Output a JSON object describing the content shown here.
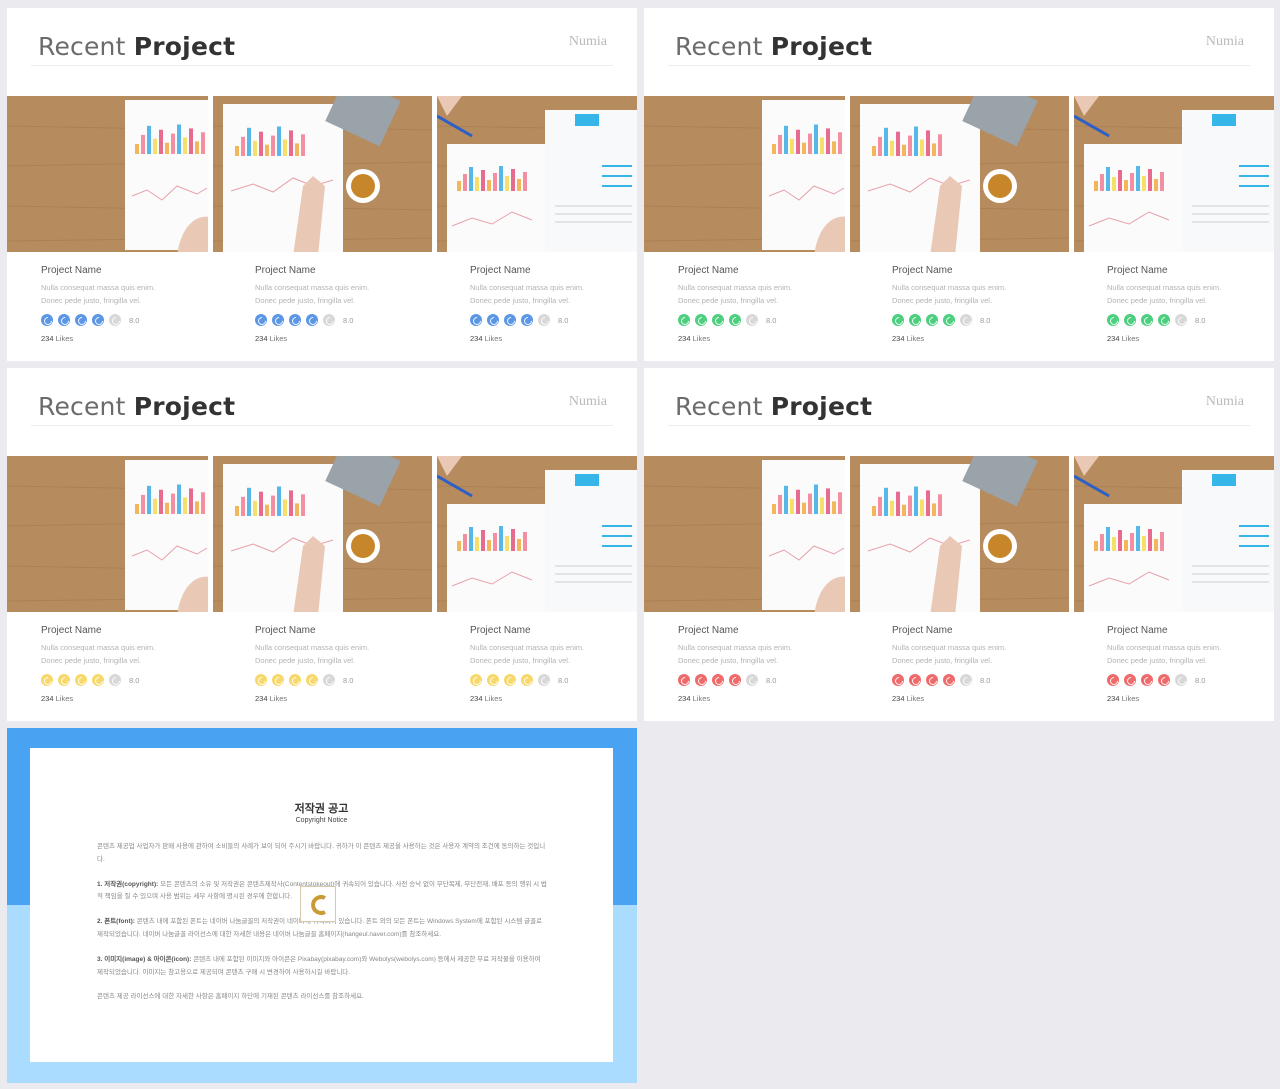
{
  "slides": [
    {
      "title_light": "Recent ",
      "title_bold": "Project",
      "brand": "Numia",
      "accent": "#5b97e6",
      "cards": [
        {
          "name": "Project Name",
          "desc1": "Nulla consequat massa quis enim.",
          "desc2": "Donec pede justo, fringilla vel.",
          "rating": 4,
          "rating_value": "8.0",
          "likes_count": "234",
          "likes_label": "Likes"
        },
        {
          "name": "Project Name",
          "desc1": "Nulla consequat massa quis enim.",
          "desc2": "Donec pede justo, fringilla vel.",
          "rating": 4,
          "rating_value": "8.0",
          "likes_count": "234",
          "likes_label": "Likes"
        },
        {
          "name": "Project Name",
          "desc1": "Nulla consequat massa quis enim.",
          "desc2": "Donec pede justo, fringilla vel.",
          "rating": 4,
          "rating_value": "8.0",
          "likes_count": "234",
          "likes_label": "Likes"
        }
      ]
    },
    {
      "title_light": "Recent ",
      "title_bold": "Project",
      "brand": "Numia",
      "accent": "#4ccf7e",
      "cards": [
        {
          "name": "Project Name",
          "desc1": "Nulla consequat massa quis enim.",
          "desc2": "Donec pede justo, fringilla vel.",
          "rating": 4,
          "rating_value": "8.0",
          "likes_count": "234",
          "likes_label": "Likes"
        },
        {
          "name": "Project Name",
          "desc1": "Nulla consequat massa quis enim.",
          "desc2": "Donec pede justo, fringilla vel.",
          "rating": 4,
          "rating_value": "8.0",
          "likes_count": "234",
          "likes_label": "Likes"
        },
        {
          "name": "Project Name",
          "desc1": "Nulla consequat massa quis enim.",
          "desc2": "Donec pede justo, fringilla vel.",
          "rating": 4,
          "rating_value": "8.0",
          "likes_count": "234",
          "likes_label": "Likes"
        }
      ]
    },
    {
      "title_light": "Recent ",
      "title_bold": "Project",
      "brand": "Numia",
      "accent": "#f6d86b",
      "cards": [
        {
          "name": "Project Name",
          "desc1": "Nulla consequat massa quis enim.",
          "desc2": "Donec pede justo, fringilla vel.",
          "rating": 4,
          "rating_value": "8.0",
          "likes_count": "234",
          "likes_label": "Likes"
        },
        {
          "name": "Project Name",
          "desc1": "Nulla consequat massa quis enim.",
          "desc2": "Donec pede justo, fringilla vel.",
          "rating": 4,
          "rating_value": "8.0",
          "likes_count": "234",
          "likes_label": "Likes"
        },
        {
          "name": "Project Name",
          "desc1": "Nulla consequat massa quis enim.",
          "desc2": "Donec pede justo, fringilla vel.",
          "rating": 4,
          "rating_value": "8.0",
          "likes_count": "234",
          "likes_label": "Likes"
        }
      ]
    },
    {
      "title_light": "Recent ",
      "title_bold": "Project",
      "brand": "Numia",
      "accent": "#ef6a6a",
      "cards": [
        {
          "name": "Project Name",
          "desc1": "Nulla consequat massa quis enim.",
          "desc2": "Donec pede justo, fringilla vel.",
          "rating": 4,
          "rating_value": "8.0",
          "likes_count": "234",
          "likes_label": "Likes"
        },
        {
          "name": "Project Name",
          "desc1": "Nulla consequat massa quis enim.",
          "desc2": "Donec pede justo, fringilla vel.",
          "rating": 4,
          "rating_value": "8.0",
          "likes_count": "234",
          "likes_label": "Likes"
        },
        {
          "name": "Project Name",
          "desc1": "Nulla consequat massa quis enim.",
          "desc2": "Donec pede justo, fringilla vel.",
          "rating": 4,
          "rating_value": "8.0",
          "likes_count": "234",
          "likes_label": "Likes"
        }
      ]
    }
  ],
  "copyright": {
    "title": "저작권 공고",
    "subtitle": "Copyright Notice",
    "intro": "콘텐츠 제공업 사업자가 판매 사용에 관하여 소비들의 사례가 보이 되어 주시기 바랍니다. 귀하가 이 콘텐츠 제공을 사용하는 것은 사용자 계약의 조건에 동의하는 것입니다.",
    "s1_head": "1. 저작권(copyright):",
    "s1_body": " 모든 콘텐츠의 소유 및 저작권은 콘텐츠제작사(Contentstokeout)에 귀속되어 있습니다. 사전 승낙 없이 무단복제, 무단전재, 배포 등의 행위 시 법적 책임을 질 수 있으며 사용 범위는 세부 사항에 명시된 경우에 한합니다.",
    "s2_head": "2. 폰트(font):",
    "s2_body": " 콘텐츠 내에 포함된 폰트는 네이버 나눔글꼴의 저작권이 네이버에 귀속되어 있습니다. 폰트 외의 모든 폰트는 Windows System에 포함된 시스템 글꼴로 제작되었습니다. 네이버 나눔글꼴 라이선스에 대한 자세한 내용은 네이버 나눔글꼴 홈페이지(hangeul.naver.com)를 참조하세요.",
    "s3_head": "3. 이미지(image) & 아이콘(icon):",
    "s3_body": " 콘텐츠 내에 포함된 이미지와 아이콘은 Pixabay(pixabay.com)와 Webolys(webolys.com) 등에서 제공한 무료 저작물을 이용하여 제작되었습니다. 이미지는 참고용으로 제공되며 콘텐츠 구매 시 변경하여 사용하시길 바랍니다.",
    "outro": "콘텐츠 제공 라이선스에 대한 자세한 사항은 홈페이지 하단에 기재된 콘텐츠 라이선스를 참조하세요."
  }
}
